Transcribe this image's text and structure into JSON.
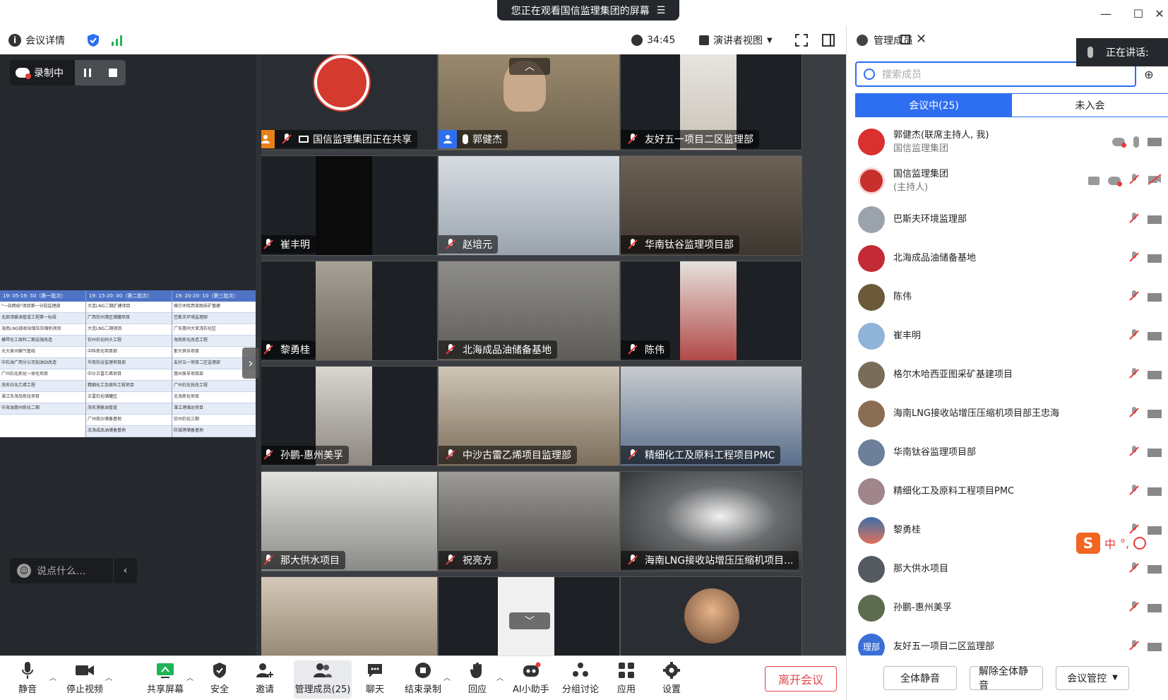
{
  "banner": {
    "text": "您正在观看国信监理集团的屏幕"
  },
  "toolbar": {
    "meeting_details": "会议详情",
    "timer": "34:45",
    "view_mode": "演讲者视图"
  },
  "left": {
    "recording_label": "录制中",
    "chat_placeholder": "说点什么..."
  },
  "shared_sheet": {
    "columns": [
      {
        "head": "19: 05-19: 50（第一批次）",
        "rows": [
          "\"一站两线\"项目第一分段监理部",
          "北部湾输油管道工程第一标段",
          "海南LNG接收站增压压缩机项目",
          "横琴化工原料二期设施改造",
          "光大泉州输气管线",
          "中石油广西分公司加油站改造",
          "广州石化炼化一体化项目",
          "茂名石化乙烯工程",
          "湛江东海岛炼化项目",
          "中海油惠州炼化二期"
        ]
      },
      {
        "head": "19: 15-20: 00（第二批次）",
        "rows": [
          "大连LNG二期扩建项目",
          "广西钦州港区储罐项目",
          "大连LNG二期项目",
          "钦州石化码头工程",
          "中科炼化项目部",
          "华南钦谷监理项目部",
          "中沙古雷乙烯项目",
          "精细化工及原料工程项目",
          "古雷石化储罐区",
          "茂名港输油管道",
          "广州南沙储备基地",
          "北海成品油储备基地"
        ]
      },
      {
        "head": "19: 20-20: 10（第三批次）",
        "rows": [
          "格尔木哈西亚图采矿基建",
          "巴斯夫环境监理部",
          "广东惠州大亚湾石化区",
          "海南炼化改造工程",
          "那大供水项目",
          "友好五一项目二区监理部",
          "惠州美孚项目部",
          "广州石化技改工程",
          "北海炼化项目",
          "湛江港储运项目",
          "钦州石化三期",
          "防城港储备基地"
        ]
      }
    ]
  },
  "tiles": [
    {
      "name": "国信监理集团正在共享",
      "role": "host"
    },
    {
      "name": "郭健杰",
      "role": "cohost"
    },
    {
      "name": "友好五一项目二区监理部"
    },
    {
      "name": "崔丰明"
    },
    {
      "name": "赵培元"
    },
    {
      "name": "华南钛谷监理项目部"
    },
    {
      "name": "黎勇桂"
    },
    {
      "name": "北海成品油储备基地"
    },
    {
      "name": "陈伟"
    },
    {
      "name": "孙鹏-惠州美孚"
    },
    {
      "name": "中沙古雷乙烯项目监理部"
    },
    {
      "name": "精细化工及原料工程项目PMC"
    },
    {
      "name": "那大供水项目"
    },
    {
      "name": "祝亮方"
    },
    {
      "name": "海南LNG接收站增压压缩机项目..."
    },
    {
      "name": ""
    },
    {
      "name": ""
    },
    {
      "name": ""
    }
  ],
  "members_panel": {
    "title": "管理成员",
    "speaking_label": "正在讲话:",
    "search_placeholder": "搜索成员",
    "tab_in_meeting": "会议中(25)",
    "tab_not_joined": "未入会",
    "members": [
      {
        "name": "郭健杰(联席主持人, 我)",
        "sub": "国信监理集团",
        "avatar_color": "#d93030"
      },
      {
        "name": "国信监理集团",
        "sub": "(主持人)",
        "avatar_color": "#c8302e"
      },
      {
        "name": "巴斯夫环境监理部",
        "sub": "",
        "avatar_color": "#9aa3ab"
      },
      {
        "name": "北海成品油储备基地",
        "sub": "",
        "avatar_color": "#c22a35"
      },
      {
        "name": "陈伟",
        "sub": "",
        "avatar_color": "#6b5a3a"
      },
      {
        "name": "崔丰明",
        "sub": "",
        "avatar_color": "#8fb4d8"
      },
      {
        "name": "格尔木哈西亚图采矿基建项目",
        "sub": "",
        "avatar_color": "#7a6c5a"
      },
      {
        "name": "海南LNG接收站增压压缩机项目部王忠海",
        "sub": "",
        "avatar_color": "#8a6d55"
      },
      {
        "name": "华南钛谷监理项目部",
        "sub": "",
        "avatar_color": "#6d7f99"
      },
      {
        "name": "精细化工及原料工程项目PMC",
        "sub": "",
        "avatar_color": "#a0858a"
      },
      {
        "name": "黎勇桂",
        "sub": "",
        "avatar_color": "#3d6fa8"
      },
      {
        "name": "那大供水项目",
        "sub": "",
        "avatar_color": "#555a60"
      },
      {
        "name": "孙鹏-惠州美孚",
        "sub": "",
        "avatar_color": "#5d6b4e"
      },
      {
        "name": "友好五一项目二区监理部",
        "sub": "",
        "avatar_color": "#3b6fd8",
        "avatar_text": "理部"
      }
    ],
    "mute_all": "全体静音",
    "unmute_all": "解除全体静音",
    "meeting_control": "会议管控"
  },
  "bottombar": {
    "mute": "静音",
    "stop_video": "停止视频",
    "share_screen": "共享屏幕",
    "security": "安全",
    "invite": "邀请",
    "manage_members": "管理成员(25)",
    "chat": "聊天",
    "end_recording": "结束录制",
    "reactions": "回应",
    "ai_assistant": "AI小助手",
    "breakout": "分组讨论",
    "apps": "应用",
    "settings": "设置",
    "leave": "离开会议"
  },
  "ime": {
    "mode": "中"
  },
  "colors": {
    "accent": "#2e6ef0",
    "leave": "#e0464b",
    "dark": "#25282d"
  }
}
